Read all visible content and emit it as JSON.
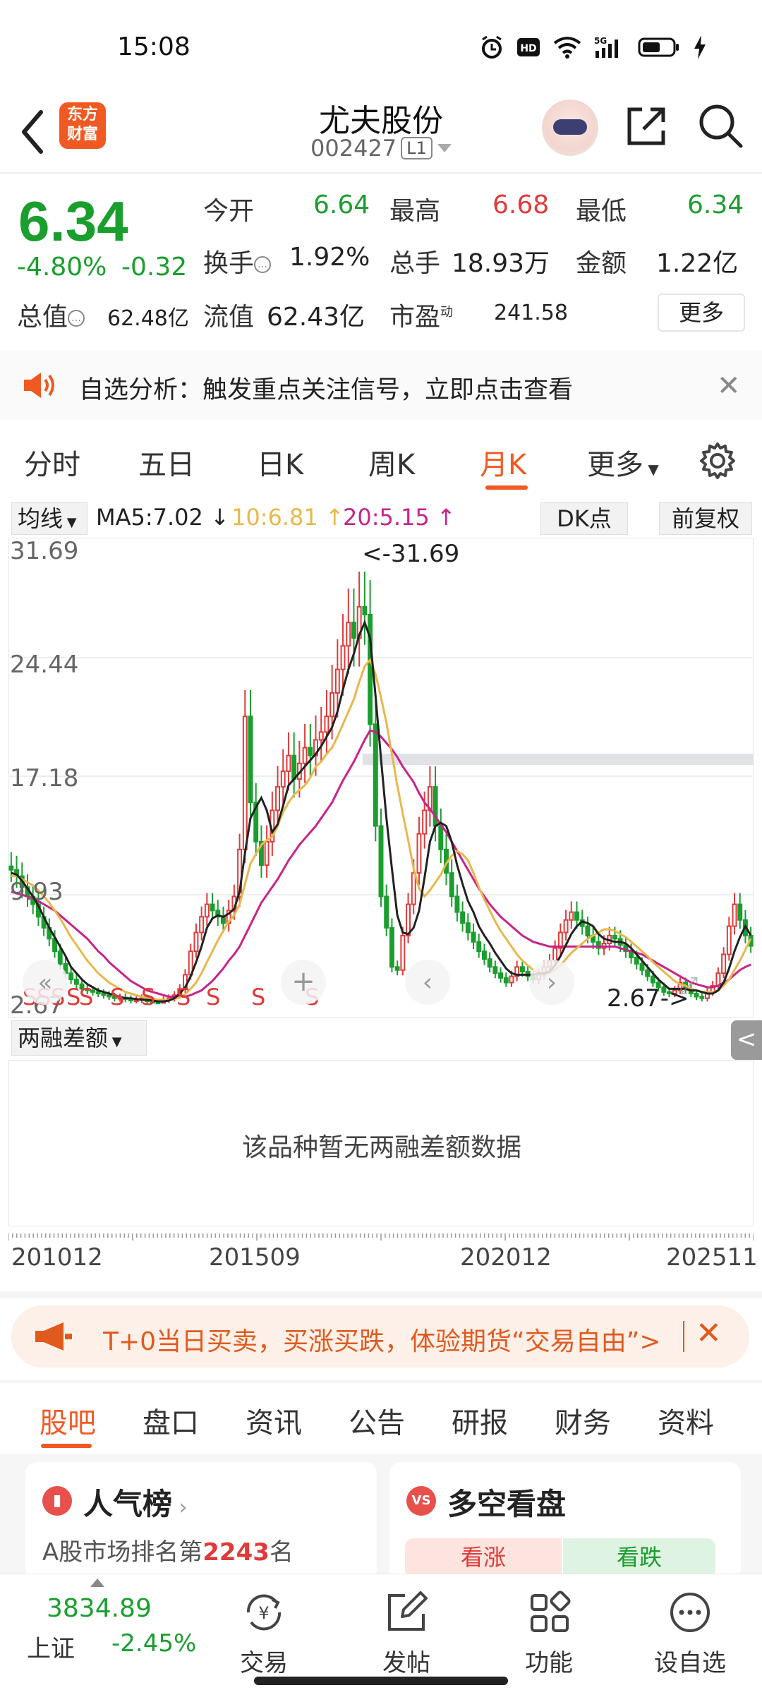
{
  "status_bar": {
    "time": "15:08",
    "icons": [
      "alarm-icon",
      "hd-icon",
      "wifi-icon",
      "signal-5g-icon",
      "battery-icon",
      "charging-icon"
    ]
  },
  "header": {
    "logo_text_top": "东方",
    "logo_text_bottom": "财富",
    "stock_name": "尤夫股份",
    "stock_code": "002427",
    "level_tag": "L1"
  },
  "quote": {
    "price": "6.34",
    "change_pct": "-4.80%",
    "change_amt": "-0.32",
    "open_label": "今开",
    "open": "6.64",
    "high_label": "最高",
    "high": "6.68",
    "low_label": "最低",
    "low": "6.34",
    "turnover_label": "换手",
    "turnover": "1.92%",
    "volume_label": "总手",
    "volume": "18.93万",
    "amount_label": "金额",
    "amount": "1.22亿",
    "mktcap_label": "总值",
    "mktcap": "62.48亿",
    "float_label": "流值",
    "float_cap": "62.43亿",
    "pe_label": "市盈",
    "pe_sup": "动",
    "pe": "241.58",
    "more_label": "更多"
  },
  "alert": {
    "text": "自选分析：触发重点关注信号，立即点击查看"
  },
  "tabs": {
    "items": [
      "分时",
      "五日",
      "日K",
      "周K",
      "月K",
      "更多"
    ],
    "active": "月K"
  },
  "chart_head": {
    "ma_select": "均线",
    "ma5": "MA5:7.02",
    "ma10": "10:6.81",
    "ma20": "20:5.15",
    "dk_label": "DK点",
    "fq_label": "前复权"
  },
  "chart_data": {
    "type": "candlestick",
    "y_ticks": [
      "31.69",
      "24.44",
      "17.18",
      "9.93",
      "2.67"
    ],
    "ylim": [
      2.67,
      31.69
    ],
    "max_annotation": "<-31.69",
    "min_annotation": "2.67->",
    "signal_marker": "S",
    "colors": {
      "up": "#e03a3a",
      "down": "#1a9e2e",
      "ma5": "#222222",
      "ma10": "#e8b84a",
      "ma20": "#c8238a"
    },
    "x_labels": [
      "201012",
      "201509",
      "202012",
      "202511"
    ],
    "close": [
      11.2,
      10.8,
      10.1,
      9.5,
      9.0,
      8.2,
      7.5,
      6.8,
      6.0,
      5.2,
      4.6,
      4.2,
      3.9,
      3.6,
      3.5,
      3.4,
      3.3,
      3.2,
      3.1,
      3.0,
      3.05,
      2.95,
      2.85,
      2.9,
      3.0,
      2.8,
      2.75,
      2.7,
      2.9,
      3.0,
      3.2,
      3.6,
      4.5,
      6.0,
      7.2,
      8.2,
      9.0,
      8.6,
      8.2,
      7.8,
      8.6,
      9.5,
      12.5,
      21.0,
      15.5,
      13.0,
      11.5,
      13.0,
      15.0,
      16.5,
      17.5,
      18.5,
      17.0,
      18.0,
      19.0,
      18.5,
      19.5,
      20.0,
      21.0,
      22.5,
      24.0,
      25.5,
      27.0,
      26.0,
      28.0,
      27.5,
      20.5,
      14.0,
      9.5,
      7.5,
      5.0,
      4.8,
      7.0,
      9.0,
      11.0,
      13.5,
      15.0,
      16.5,
      14.0,
      12.5,
      11.0,
      9.5,
      8.5,
      7.8,
      7.2,
      6.6,
      6.0,
      5.5,
      5.0,
      4.6,
      4.3,
      4.0,
      4.4,
      5.0,
      4.7,
      4.4,
      4.2,
      4.5,
      5.0,
      5.4,
      6.2,
      7.2,
      8.0,
      8.5,
      8.0,
      7.6,
      7.0,
      6.6,
      6.2,
      6.5,
      7.0,
      6.8,
      6.4,
      6.0,
      5.6,
      5.2,
      4.8,
      4.4,
      4.0,
      3.7,
      3.4,
      3.3,
      3.5,
      4.0,
      3.6,
      3.3,
      3.1,
      3.0,
      3.4,
      3.8,
      4.6,
      5.8,
      7.6,
      9.0,
      8.0,
      7.0,
      6.34
    ],
    "ma5": [
      11.0,
      10.9,
      10.5,
      10.0,
      9.5,
      8.9,
      8.2,
      7.5,
      6.9,
      6.3,
      5.7,
      5.0,
      4.6,
      4.2,
      3.9,
      3.7,
      3.5,
      3.4,
      3.3,
      3.2,
      3.1,
      3.0,
      3.0,
      2.95,
      2.9,
      2.9,
      2.85,
      2.8,
      2.8,
      2.85,
      3.0,
      3.3,
      3.7,
      4.4,
      5.3,
      6.3,
      7.5,
      8.1,
      8.3,
      8.2,
      8.4,
      8.7,
      9.8,
      12.3,
      14.5,
      15.2,
      15.8,
      15.0,
      13.6,
      14.1,
      15.3,
      16.6,
      17.0,
      17.4,
      17.8,
      18.2,
      18.6,
      19.1,
      19.7,
      20.3,
      21.3,
      22.7,
      24.0,
      25.0,
      26.2,
      27.0,
      26.0,
      22.3,
      18.3,
      14.5,
      11.3,
      8.3,
      7.2,
      7.1,
      7.5,
      8.6,
      10.7,
      13.0,
      14.0,
      14.2,
      14.0,
      13.0,
      11.5,
      10.3,
      9.2,
      8.5,
      7.6,
      7.0,
      6.5,
      5.9,
      5.4,
      4.9,
      4.6,
      4.5,
      4.5,
      4.5,
      4.5,
      4.6,
      4.6,
      4.7,
      5.1,
      5.7,
      6.4,
      7.1,
      7.6,
      7.9,
      7.8,
      7.6,
      7.1,
      6.8,
      6.7,
      6.6,
      6.6,
      6.5,
      6.2,
      5.8,
      5.4,
      5.0,
      4.6,
      4.2,
      3.9,
      3.6,
      3.6,
      3.6,
      3.6,
      3.5,
      3.5,
      3.4,
      3.3,
      3.3,
      3.5,
      4.0,
      4.9,
      6.0,
      6.9,
      7.6,
      7.02
    ],
    "ma10": [
      10.8,
      10.8,
      10.6,
      10.4,
      10.2,
      9.9,
      9.5,
      9.1,
      8.6,
      8.1,
      7.5,
      6.9,
      6.4,
      5.9,
      5.4,
      5.0,
      4.6,
      4.3,
      4.0,
      3.8,
      3.6,
      3.4,
      3.3,
      3.2,
      3.1,
      3.0,
      3.0,
      2.9,
      2.9,
      2.9,
      2.95,
      3.05,
      3.25,
      3.6,
      4.0,
      4.6,
      5.3,
      6.0,
      6.7,
      7.3,
      7.9,
      8.3,
      9.0,
      10.3,
      11.6,
      12.2,
      12.8,
      13.1,
      13.3,
      14.0,
      14.9,
      15.5,
      16.0,
      16.3,
      16.6,
      17.1,
      17.8,
      18.1,
      18.6,
      19.0,
      19.7,
      20.5,
      21.3,
      22.1,
      23.2,
      24.2,
      24.6,
      23.7,
      22.2,
      20.6,
      18.6,
      16.6,
      14.8,
      13.1,
      11.3,
      10.0,
      9.5,
      9.9,
      10.4,
      10.9,
      11.6,
      12.1,
      12.4,
      12.2,
      11.8,
      11.0,
      10.1,
      9.3,
      8.6,
      7.9,
      7.3,
      6.8,
      6.3,
      5.8,
      5.4,
      5.1,
      4.8,
      4.6,
      4.6,
      4.6,
      4.8,
      5.1,
      5.5,
      5.9,
      6.2,
      6.5,
      6.8,
      7.0,
      7.2,
      7.4,
      7.4,
      7.3,
      7.1,
      6.9,
      6.6,
      6.3,
      6.0,
      5.7,
      5.3,
      5.0,
      4.7,
      4.4,
      4.1,
      3.9,
      3.8,
      3.6,
      3.5,
      3.4,
      3.4,
      3.4,
      3.5,
      3.8,
      4.2,
      4.8,
      5.4,
      6.1,
      6.81
    ],
    "ma20": [
      9.8,
      9.7,
      9.6,
      9.5,
      9.4,
      9.2,
      9.0,
      8.8,
      8.6,
      8.3,
      8.0,
      7.7,
      7.4,
      7.1,
      6.8,
      6.4,
      6.0,
      5.7,
      5.3,
      5.0,
      4.7,
      4.4,
      4.1,
      3.9,
      3.7,
      3.5,
      3.4,
      3.3,
      3.2,
      3.1,
      3.1,
      3.1,
      3.1,
      3.2,
      3.35,
      3.5,
      3.8,
      4.1,
      4.5,
      4.9,
      5.4,
      5.8,
      6.3,
      7.0,
      7.7,
      8.4,
      9.1,
      9.6,
      10.1,
      10.6,
      11.2,
      11.8,
      12.3,
      12.8,
      13.2,
      13.6,
      14.0,
      14.5,
      15.0,
      15.5,
      16.2,
      16.9,
      17.5,
      18.1,
      18.8,
      19.5,
      20.1,
      20.0,
      19.7,
      19.3,
      18.9,
      18.4,
      17.8,
      17.3,
      16.8,
      16.1,
      15.5,
      15.1,
      14.6,
      14.1,
      13.6,
      13.0,
      12.4,
      11.8,
      11.2,
      10.6,
      10.0,
      9.5,
      9.0,
      8.6,
      8.2,
      7.9,
      7.6,
      7.3,
      7.0,
      6.8,
      6.6,
      6.5,
      6.4,
      6.3,
      6.3,
      6.3,
      6.3,
      6.3,
      6.3,
      6.3,
      6.3,
      6.3,
      6.3,
      6.3,
      6.3,
      6.3,
      6.2,
      6.1,
      6.0,
      5.9,
      5.8,
      5.6,
      5.4,
      5.2,
      5.0,
      4.8,
      4.6,
      4.4,
      4.2,
      4.0,
      3.9,
      3.8,
      3.7,
      3.7,
      3.8,
      4.0,
      4.2,
      4.5,
      4.8,
      5.0,
      5.15
    ]
  },
  "margin_panel": {
    "select_label": "两融差额",
    "no_data_text": "该品种暂无两融差额数据",
    "side_tab": "<"
  },
  "date_axis": {
    "labels": [
      "201012",
      "201509",
      "202012",
      "202511"
    ]
  },
  "promo": {
    "text": "T+0当日买卖，买涨买跌，体验期货“交易自由”>"
  },
  "sub_tabs": {
    "items": [
      "股吧",
      "盘口",
      "资讯",
      "公告",
      "研报",
      "财务",
      "资料"
    ],
    "active": "股吧"
  },
  "cards": {
    "popularity_title": "人气榜",
    "popularity_rank_prefix": "A股市场排名第",
    "popularity_rank": "2243",
    "popularity_rank_suffix": "名",
    "bullbear_title": "多空看盘",
    "bull_label": "看涨",
    "bear_label": "看跌"
  },
  "bottom_nav": {
    "index_value": "3834.89",
    "index_name": "上证",
    "index_pct": "-2.45%",
    "items": [
      {
        "label": "交易",
        "icon": "trade-icon"
      },
      {
        "label": "发帖",
        "icon": "post-icon"
      },
      {
        "label": "功能",
        "icon": "function-icon"
      },
      {
        "label": "设自选",
        "icon": "add-favorite-icon"
      }
    ]
  }
}
